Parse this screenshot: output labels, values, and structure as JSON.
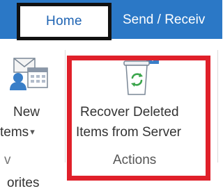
{
  "tabs": {
    "home": "Home",
    "send_receive": "Send / Receiv"
  },
  "new_items": {
    "line1": "New",
    "line2": "tems",
    "caret": "▾",
    "icon": "new-items-icon"
  },
  "group_left_label": "v",
  "recover": {
    "line1": "Recover Deleted",
    "line2": "Items from Server",
    "icon": "recycle-bin-icon"
  },
  "actions_group_label": "Actions",
  "below_text": "orites",
  "colors": {
    "tab_bar": "#2b78c6",
    "home_text": "#1f64b3",
    "highlight_red": "#e0202a",
    "home_border": "#111111"
  }
}
